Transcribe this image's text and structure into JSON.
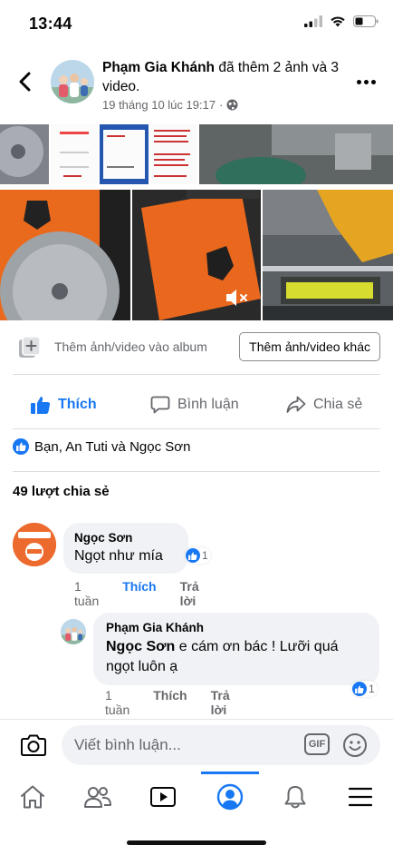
{
  "status_bar": {
    "time": "13:44"
  },
  "header": {
    "author": "Phạm Gia Khánh",
    "action": "đã thêm 2 ảnh và 3 video.",
    "timestamp": "19 tháng 10 lúc 19:17",
    "separator": "·"
  },
  "album": {
    "add_to_album_label": "Thêm ảnh/video vào album",
    "add_more_button": "Thêm ảnh/video khác"
  },
  "actions": {
    "like": "Thích",
    "comment": "Bình luận",
    "share": "Chia sẻ"
  },
  "reactions": {
    "summary": "Bạn, An Tuti và Ngọc Sơn"
  },
  "shares": {
    "count_label": "49 lượt chia sẻ"
  },
  "comments": [
    {
      "author": "Ngọc Sơn",
      "text": "Ngọt như mía",
      "time": "1 tuần",
      "like_label": "Thích",
      "reply_label": "Trả lời",
      "reaction_count": "1"
    },
    {
      "author": "Phạm Gia Khánh",
      "mention": "Ngọc Sơn",
      "text": "e cám ơn bác ! Lưỡi quá ngọt luôn ạ",
      "time": "1 tuần",
      "like_label": "Thích",
      "reply_label": "Trả lời",
      "reaction_count": "1"
    }
  ],
  "composer": {
    "placeholder": "Viết bình luận...",
    "gif_label": "GIF"
  },
  "tabs": [
    "home-icon",
    "friends-icon",
    "watch-icon",
    "profile-icon",
    "notifications-icon",
    "menu-icon"
  ],
  "colors": {
    "accent": "#1877f2",
    "muted": "#65676b",
    "bubble": "#f0f2f5",
    "blade_orange": "#ee6a1e"
  }
}
